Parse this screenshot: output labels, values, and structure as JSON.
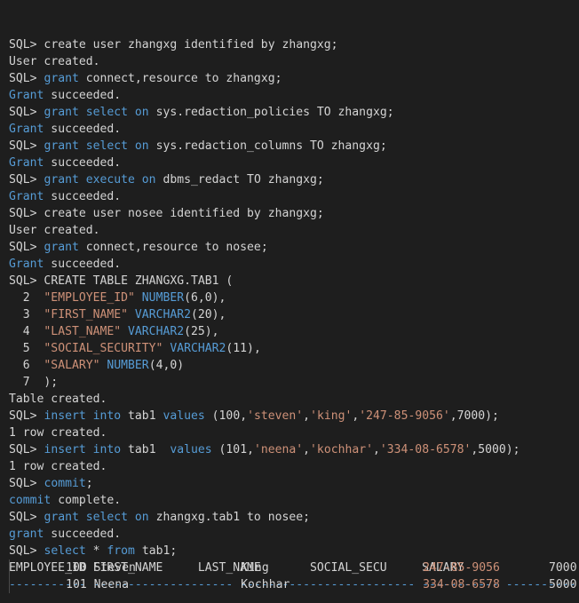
{
  "terminal": {
    "lines": [
      {
        "prompt": "SQL>",
        "parts": [
          {
            "t": " create user zhangxg identified by zhangxg;",
            "c": ""
          }
        ]
      },
      {
        "parts": [
          {
            "t": "User created.",
            "c": ""
          }
        ]
      },
      {
        "prompt": "SQL>",
        "parts": [
          {
            "t": " ",
            "c": ""
          },
          {
            "t": "grant",
            "c": "kw"
          },
          {
            "t": " connect,resource to zhangxg;",
            "c": ""
          }
        ]
      },
      {
        "parts": [
          {
            "t": "Grant",
            "c": "kw"
          },
          {
            "t": " succeeded.",
            "c": ""
          }
        ]
      },
      {
        "prompt": "SQL>",
        "parts": [
          {
            "t": " ",
            "c": ""
          },
          {
            "t": "grant select on",
            "c": "kw"
          },
          {
            "t": " sys.redaction_policies TO zhangxg;",
            "c": ""
          }
        ]
      },
      {
        "parts": [
          {
            "t": "Grant",
            "c": "kw"
          },
          {
            "t": " succeeded.",
            "c": ""
          }
        ]
      },
      {
        "prompt": "SQL>",
        "parts": [
          {
            "t": " ",
            "c": ""
          },
          {
            "t": "grant select on",
            "c": "kw"
          },
          {
            "t": " sys.redaction_columns TO zhangxg;",
            "c": ""
          }
        ]
      },
      {
        "parts": [
          {
            "t": "Grant",
            "c": "kw"
          },
          {
            "t": " succeeded.",
            "c": ""
          }
        ]
      },
      {
        "prompt": "SQL>",
        "parts": [
          {
            "t": " ",
            "c": ""
          },
          {
            "t": "grant execute on",
            "c": "kw"
          },
          {
            "t": " dbms_redact TO zhangxg;",
            "c": ""
          }
        ]
      },
      {
        "parts": [
          {
            "t": "Grant",
            "c": "kw"
          },
          {
            "t": " succeeded.",
            "c": ""
          }
        ]
      },
      {
        "prompt": "SQL>",
        "parts": [
          {
            "t": " create user nosee identified by zhangxg;",
            "c": ""
          }
        ]
      },
      {
        "parts": [
          {
            "t": "User created.",
            "c": ""
          }
        ]
      },
      {
        "prompt": "SQL>",
        "parts": [
          {
            "t": " ",
            "c": ""
          },
          {
            "t": "grant",
            "c": "kw"
          },
          {
            "t": " connect,resource to nosee;",
            "c": ""
          }
        ]
      },
      {
        "parts": [
          {
            "t": "Grant",
            "c": "kw"
          },
          {
            "t": " succeeded.",
            "c": ""
          }
        ]
      },
      {
        "prompt": "SQL>",
        "parts": [
          {
            "t": " CREATE TABLE ZHANGXG.TAB1 (",
            "c": ""
          }
        ]
      },
      {
        "parts": [
          {
            "t": "  2  ",
            "c": "ln"
          },
          {
            "t": "\"EMPLOYEE_ID\"",
            "c": "str"
          },
          {
            "t": " ",
            "c": ""
          },
          {
            "t": "NUMBER",
            "c": "kw"
          },
          {
            "t": "(6,0),",
            "c": ""
          }
        ]
      },
      {
        "parts": [
          {
            "t": "  3  ",
            "c": "ln"
          },
          {
            "t": "\"FIRST_NAME\"",
            "c": "str"
          },
          {
            "t": " ",
            "c": ""
          },
          {
            "t": "VARCHAR2",
            "c": "kw"
          },
          {
            "t": "(20),",
            "c": ""
          }
        ]
      },
      {
        "parts": [
          {
            "t": "  4  ",
            "c": "ln"
          },
          {
            "t": "\"LAST_NAME\"",
            "c": "str"
          },
          {
            "t": " ",
            "c": ""
          },
          {
            "t": "VARCHAR2",
            "c": "kw"
          },
          {
            "t": "(25),",
            "c": ""
          }
        ]
      },
      {
        "parts": [
          {
            "t": "  5  ",
            "c": "ln"
          },
          {
            "t": "\"SOCIAL_SECURITY\"",
            "c": "str"
          },
          {
            "t": " ",
            "c": ""
          },
          {
            "t": "VARCHAR2",
            "c": "kw"
          },
          {
            "t": "(11),",
            "c": ""
          }
        ]
      },
      {
        "parts": [
          {
            "t": "  6  ",
            "c": "ln"
          },
          {
            "t": "\"SALARY\"",
            "c": "str"
          },
          {
            "t": " ",
            "c": ""
          },
          {
            "t": "NUMBER",
            "c": "kw"
          },
          {
            "t": "(4,0)",
            "c": ""
          }
        ]
      },
      {
        "parts": [
          {
            "t": "  7  ",
            "c": "ln"
          },
          {
            "t": ");",
            "c": ""
          }
        ]
      },
      {
        "parts": [
          {
            "t": "Table created.",
            "c": ""
          }
        ]
      },
      {
        "prompt": "SQL>",
        "parts": [
          {
            "t": " ",
            "c": ""
          },
          {
            "t": "insert into",
            "c": "kw"
          },
          {
            "t": " tab1 ",
            "c": ""
          },
          {
            "t": "values",
            "c": "kw"
          },
          {
            "t": " (100,",
            "c": ""
          },
          {
            "t": "'steven'",
            "c": "str"
          },
          {
            "t": ",",
            "c": ""
          },
          {
            "t": "'king'",
            "c": "str"
          },
          {
            "t": ",",
            "c": ""
          },
          {
            "t": "'247-85-9056'",
            "c": "str"
          },
          {
            "t": ",7000);",
            "c": ""
          }
        ]
      },
      {
        "parts": [
          {
            "t": "1 row created.",
            "c": ""
          }
        ]
      },
      {
        "prompt": "SQL>",
        "parts": [
          {
            "t": " ",
            "c": ""
          },
          {
            "t": "insert into",
            "c": "kw"
          },
          {
            "t": " tab1  ",
            "c": ""
          },
          {
            "t": "values",
            "c": "kw"
          },
          {
            "t": " (101,",
            "c": ""
          },
          {
            "t": "'neena'",
            "c": "str"
          },
          {
            "t": ",",
            "c": ""
          },
          {
            "t": "'kochhar'",
            "c": "str"
          },
          {
            "t": ",",
            "c": ""
          },
          {
            "t": "'334-08-6578'",
            "c": "str"
          },
          {
            "t": ",5000);",
            "c": ""
          }
        ]
      },
      {
        "parts": [
          {
            "t": "1 row created.",
            "c": ""
          }
        ]
      },
      {
        "prompt": "SQL>",
        "parts": [
          {
            "t": " ",
            "c": ""
          },
          {
            "t": "commit",
            "c": "kw"
          },
          {
            "t": ";",
            "c": ""
          }
        ]
      },
      {
        "parts": [
          {
            "t": "commit",
            "c": "kw"
          },
          {
            "t": " complete.",
            "c": ""
          }
        ]
      },
      {
        "prompt": "SQL>",
        "parts": [
          {
            "t": " ",
            "c": ""
          },
          {
            "t": "grant select on",
            "c": "kw"
          },
          {
            "t": " zhangxg.tab1 to nosee;",
            "c": ""
          }
        ]
      },
      {
        "parts": [
          {
            "t": "grant",
            "c": "kw"
          },
          {
            "t": " succeeded.",
            "c": ""
          }
        ]
      },
      {
        "prompt": "SQL>",
        "parts": [
          {
            "t": " ",
            "c": ""
          },
          {
            "t": "select",
            "c": "kw"
          },
          {
            "t": " * ",
            "c": ""
          },
          {
            "t": "from",
            "c": "kw"
          },
          {
            "t": " tab1;",
            "c": ""
          }
        ]
      },
      {
        "parts": [
          {
            "t": "EMPLOYEE_ID FIRST_NAME     LAST_NAME       SOCIAL_SECU     SALARY",
            "c": ""
          }
        ]
      },
      {
        "parts": [
          {
            "t": "----------- -------------------- ------------------------- ----------- ----------",
            "c": "dash"
          }
        ]
      }
    ],
    "result_rows": [
      {
        "parts": [
          {
            "t": "        100 ",
            "c": ""
          },
          {
            "t": "Steven",
            "c": ""
          },
          {
            "t": "               King                      ",
            "c": ""
          },
          {
            "t": "247-85-9056",
            "c": "str"
          },
          {
            "t": "       7000",
            "c": ""
          }
        ]
      },
      {
        "parts": [
          {
            "t": "        101 ",
            "c": ""
          },
          {
            "t": "Neena",
            "c": ""
          },
          {
            "t": "                Kochhar                   ",
            "c": ""
          },
          {
            "t": "334-08-6578",
            "c": "str"
          },
          {
            "t": "       5000",
            "c": ""
          }
        ]
      }
    ]
  },
  "colors": {
    "background": "#1e1e1e",
    "text": "#d4d4d4",
    "keyword": "#569cd6",
    "string": "#ce9178"
  }
}
